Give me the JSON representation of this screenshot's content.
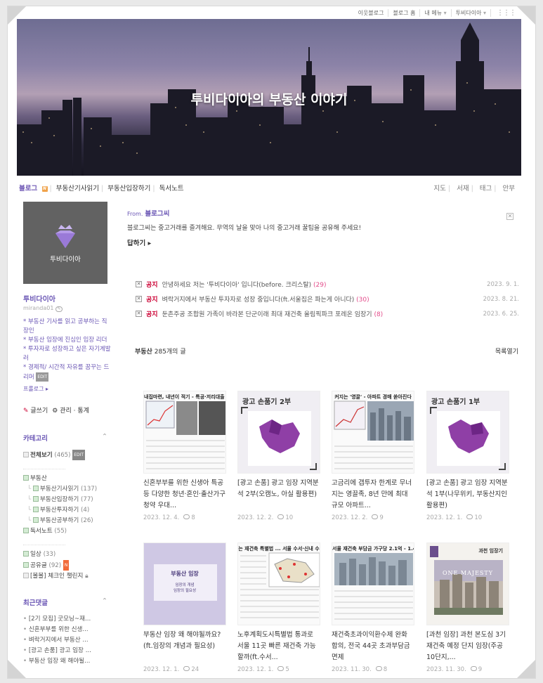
{
  "gnb": {
    "items": [
      "이웃블로그",
      "블로그 홈",
      "내 메뉴",
      "투비다이아"
    ]
  },
  "blog": {
    "title": "투비다이아의 부동산 이야기"
  },
  "nav": {
    "left": [
      "블로그",
      "부동산기사읽기",
      "부동산입장하기",
      "독서노트"
    ],
    "right": [
      "지도",
      "서재",
      "태그",
      "안부"
    ]
  },
  "profile": {
    "image_label": "투비다이아",
    "nickname": "투비다이아",
    "user_id": "miranda01",
    "intro": [
      "* 부동산 기사를 읽고 공부하는 직장인",
      "* 부동산 임장에 진심인 임장 리더",
      "* 투자자로 성장하고 싶은 자기계발러",
      "* 경제적/ 시간적 자유를 꿈꾸는 드리머"
    ],
    "edit_tag": "EDIT",
    "prolog": "프롤로그",
    "write": "글쓰기",
    "admin": "관리 · 통계"
  },
  "categories": {
    "header": "카테고리",
    "all": {
      "label": "전체보기",
      "count": "(465)"
    },
    "items": [
      {
        "label": "부동산",
        "count": "",
        "sub": false
      },
      {
        "label": "부동산기사읽기",
        "count": "(137)",
        "sub": true
      },
      {
        "label": "부동산입장하기",
        "count": "(77)",
        "sub": true
      },
      {
        "label": "부동산투자하기",
        "count": "(4)",
        "sub": true
      },
      {
        "label": "부동산공부하기",
        "count": "(26)",
        "sub": true
      },
      {
        "label": "독서노트",
        "count": "(55)",
        "sub": false
      },
      {
        "label": "일상",
        "count": "(33)",
        "sub": false
      },
      {
        "label": "공유글",
        "count": "(92)",
        "sub": false
      },
      {
        "label": "[볼볼] 체크인 챌린지",
        "count": "",
        "sub": false
      }
    ]
  },
  "recent_comments": {
    "header": "최근댓글",
    "items": [
      "[2기 모집] 굿모닝~재...",
      "신혼부부를 위한 신생...",
      "벼락거지에서 부동산 ...",
      "[광고 손품] 광고 임장 ...",
      "부동산 임장 왜 해야될..."
    ]
  },
  "guest": {
    "from_label": "From.",
    "from_name": "블로그씨",
    "message": "블로그씨는 중고거래를 즐겨해요. 무역의 날을 맞아 나의 중고거래 꿀팁을 공유해 주세요!",
    "reply": "답하기 ▸"
  },
  "notices": [
    {
      "tag": "공지",
      "title": "안녕하세요 저는 '투비다이아' 입니다(before. 크리스탈)",
      "comments": "(29)",
      "date": "2023. 9. 1."
    },
    {
      "tag": "공지",
      "title": "벼락거지에서 부동산 투자자로 성장 중입니다(ft.서울집은 파는게 아니다)",
      "comments": "(30)",
      "date": "2023. 8. 21."
    },
    {
      "tag": "공지",
      "title": "둔촌주공 조합원 가족이 바라본 단군이래 최대 재건축 올림픽파크 포레온 임장기",
      "comments": "(8)",
      "date": "2023. 6. 25."
    }
  ],
  "list": {
    "category": "부동산",
    "count": "285개의 글",
    "toggle": "목록열기"
  },
  "posts": [
    {
      "thumb_heading": "내집마련, 내년이 적기 - 특공·저리대출 집",
      "title": "신혼부부를 위한 신생아 특공 등 다양한 청년·혼인·출산가구 청약 우대...",
      "date": "2023. 12. 4.",
      "comments": "8"
    },
    {
      "thumb_heading": "광고 손품기 2부",
      "title": "[광고 손품] 광고 임장 지역분석 2부(오캠노, 아실 활용편)",
      "date": "2023. 12. 2.",
      "comments": "10"
    },
    {
      "thumb_heading": "커지는 '영끌' - 아파트 경매 쏟아진다",
      "title": "고금리에 갭투자 한계로 무너지는 영끌족, 8년 만에 최대 규모 아파트...",
      "date": "2023. 12. 2.",
      "comments": "9"
    },
    {
      "thumb_heading": "광고 손품기 1부",
      "title": "[광고 손품] 광고 임장 지역분석 1부(나무위키, 부동산지인 활용편)",
      "date": "2023. 12. 1.",
      "comments": "10"
    },
    {
      "thumb_heading": "부동산 임장",
      "thumb_sub": "임장의 개념\n임장의 필요성",
      "title": "부동산 임장 왜 해야될까요? (ft.임장의 개념과 필요성)",
      "date": "2023. 12. 1.",
      "comments": "24"
    },
    {
      "thumb_heading": "는 재건축 특별법 ... 서울 수서·신내 수",
      "title": "노후계획도시특별법 통과로 서울 11곳 빠른 재건축 가능할까(ft.수서...",
      "date": "2023. 12. 1.",
      "comments": "5"
    },
    {
      "thumb_heading": "서울 재건축 부담금 가구당 2.1억 - 1.4",
      "title": "재건축초과이익환수제 완화 합의, 전국 44곳 초과부담금 면제",
      "date": "2023. 11. 30.",
      "comments": "8"
    },
    {
      "thumb_heading": "과천 임장기",
      "thumb_sub": "ONE MAJESTY",
      "title": "[과천 임장] 과천 본도심 3기 재건축 예정 단지 임장(주공 10단지,...",
      "date": "2023. 11. 30.",
      "comments": "9"
    }
  ]
}
